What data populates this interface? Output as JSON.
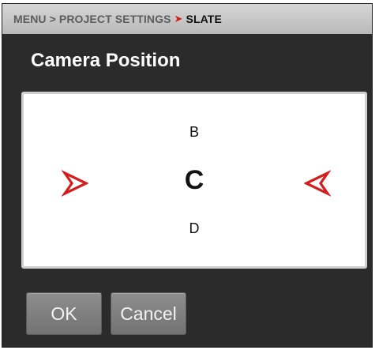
{
  "breadcrumb": {
    "items": [
      "MENU",
      "PROJECT SETTINGS",
      "SLATE"
    ],
    "separator": ">"
  },
  "title": "Camera Position",
  "positions": {
    "up": "B",
    "current": "C",
    "down": "D"
  },
  "buttons": {
    "ok": "OK",
    "cancel": "Cancel"
  },
  "icons": {
    "left": "arrow-right-icon",
    "right": "arrow-left-icon"
  },
  "colors": {
    "accent": "#d21e1e",
    "background": "#2b2b2b",
    "panel": "#ffffff"
  }
}
